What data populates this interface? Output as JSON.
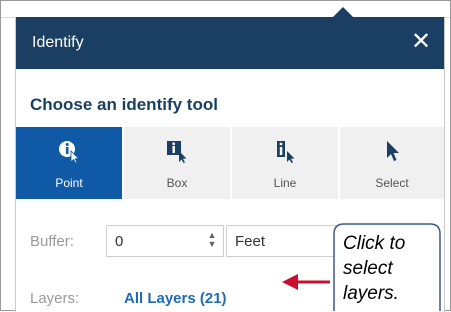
{
  "panel": {
    "title": "Identify",
    "close_glyph": "✕",
    "section_title": "Choose an identify tool"
  },
  "tools": [
    {
      "label": "Point",
      "icon": "point-identify-icon",
      "active": true
    },
    {
      "label": "Box",
      "icon": "box-identify-icon",
      "active": false
    },
    {
      "label": "Line",
      "icon": "line-identify-icon",
      "active": false
    },
    {
      "label": "Select",
      "icon": "select-cursor-icon",
      "active": false
    }
  ],
  "buffer": {
    "label": "Buffer:",
    "value": "0",
    "unit": "Feet"
  },
  "layers": {
    "label": "Layers:",
    "value": "All Layers (21)"
  },
  "callout": {
    "text": "Click to select layers."
  },
  "colors": {
    "header": "#1a3f63",
    "active_tool": "#1059a6",
    "link": "#1f6bb5",
    "arrow": "#c8102e"
  }
}
